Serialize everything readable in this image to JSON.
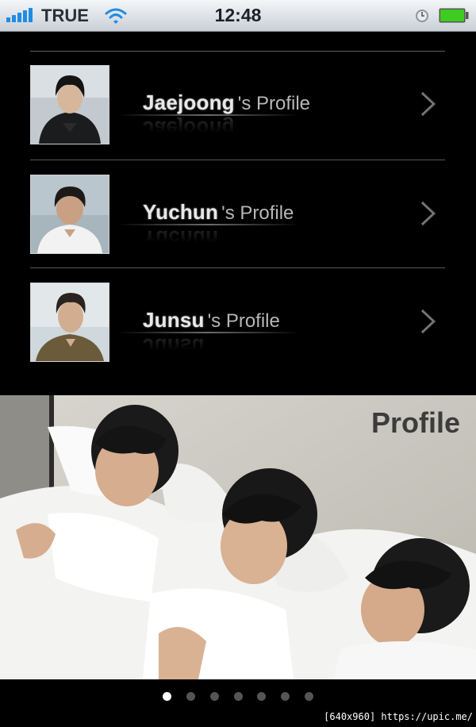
{
  "status_bar": {
    "carrier": "TRUE",
    "time": "12:48",
    "icons": [
      "signal-bars-icon",
      "wifi-icon",
      "alarm-clock-icon",
      "battery-icon"
    ]
  },
  "profiles": [
    {
      "name": "Jaejoong",
      "suffix": "'s Profile",
      "icon": "chevron-right-icon"
    },
    {
      "name": "Yuchun",
      "suffix": "'s Profile",
      "icon": "chevron-right-icon"
    },
    {
      "name": "Junsu",
      "suffix": "'s Profile",
      "icon": "chevron-right-icon"
    }
  ],
  "banner": {
    "title": "Profile"
  },
  "pager": {
    "page_count": 7,
    "current_page": 1
  },
  "watermark": "[640x960] https://upic.me/",
  "colors": {
    "background": "#000000",
    "status_bar": "#dfe3e8",
    "battery_fill": "#3dcc1f",
    "signal": "#1f8ce6"
  }
}
